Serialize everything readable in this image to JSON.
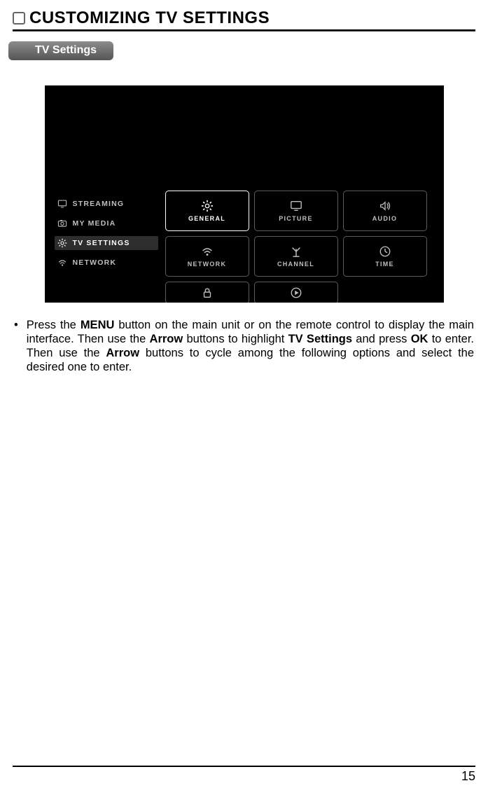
{
  "page": {
    "title": "CUSTOMIZING TV SETTINGS",
    "section_chip": "TV Settings",
    "page_number": "15"
  },
  "sidebar": {
    "items": [
      {
        "icon": "monitor-icon",
        "label": "STREAMING",
        "selected": false
      },
      {
        "icon": "camera-icon",
        "label": "MY MEDIA",
        "selected": false
      },
      {
        "icon": "gear-icon",
        "label": "TV SETTINGS",
        "selected": true
      },
      {
        "icon": "wifi-icon",
        "label": "NETWORK",
        "selected": false
      }
    ]
  },
  "tiles": [
    {
      "icon": "gear-icon",
      "label": "GENERAL",
      "selected": true
    },
    {
      "icon": "monitor-icon",
      "label": "PICTURE",
      "selected": false
    },
    {
      "icon": "sound-icon",
      "label": "AUDIO",
      "selected": false
    },
    {
      "icon": "wifi-icon",
      "label": "NETWORK",
      "selected": false
    },
    {
      "icon": "antenna-icon",
      "label": "CHANNEL",
      "selected": false
    },
    {
      "icon": "clock-icon",
      "label": "TIME",
      "selected": false
    },
    {
      "icon": "lock-icon",
      "label": "",
      "selected": false,
      "half": true
    },
    {
      "icon": "play-icon",
      "label": "",
      "selected": false,
      "half": true
    }
  ],
  "instruction": {
    "text_parts": {
      "p1": "Press the ",
      "b1": "MENU",
      "p2": " button on the main unit or on the remote control to display the main interface. Then use the ",
      "b2": "Arrow",
      "p3": " buttons to highlight ",
      "b3": "TV Settings",
      "p4": " and press ",
      "b4": "OK",
      "p5": " to enter. Then use the ",
      "b5": "Arrow",
      "p6": " buttons to cycle among the following options and select the desired one to enter."
    }
  }
}
